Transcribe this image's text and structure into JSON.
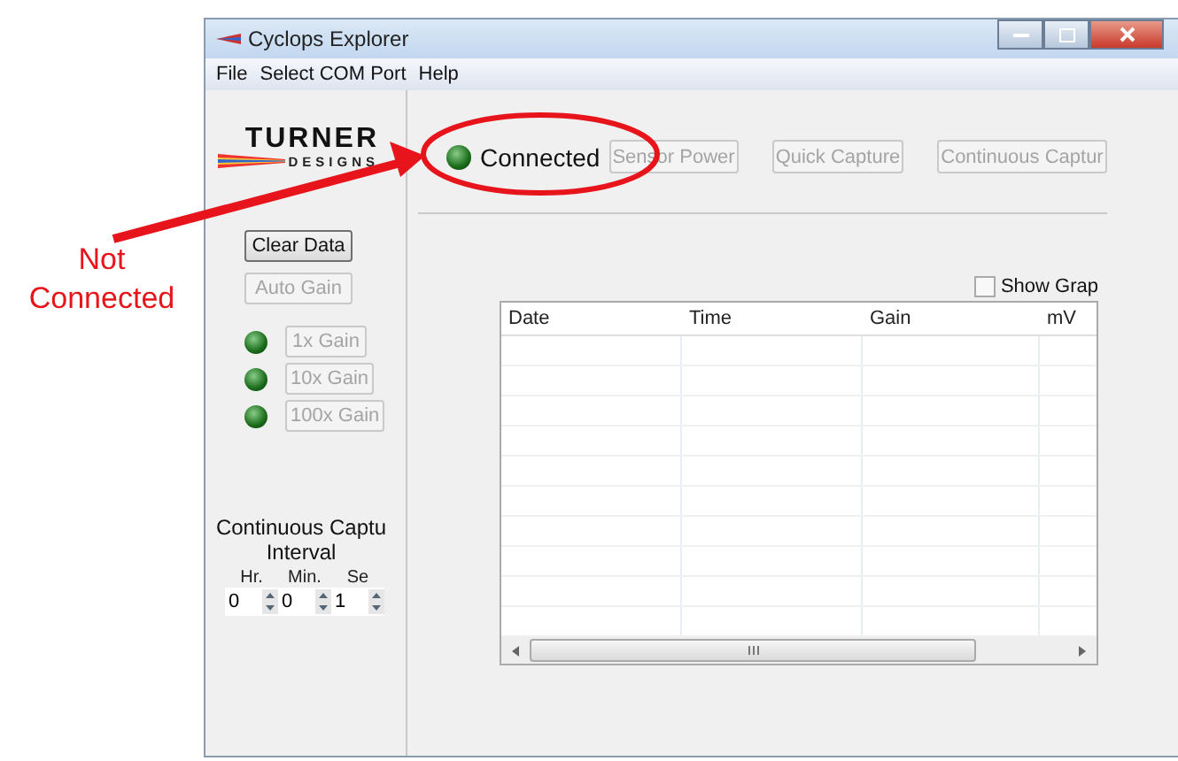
{
  "annotation": {
    "callout": "Not Connected"
  },
  "window": {
    "title": "Cyclops Explorer"
  },
  "menu": [
    "File",
    "Select COM Port",
    "Help"
  ],
  "logo": {
    "line_1": "TURNER",
    "line_2": "DESIGNS"
  },
  "status": {
    "led_on": true,
    "label": "Connected"
  },
  "toolbar_buttons": [
    {
      "label": "Sensor Power",
      "disabled": true
    },
    {
      "label": "Quick Capture",
      "disabled": true
    },
    {
      "label": "Continuous Captur",
      "disabled": true
    }
  ],
  "side_buttons": [
    {
      "label": "Clear Data",
      "disabled": false
    },
    {
      "label": "Auto Gain",
      "disabled": true
    }
  ],
  "gains": [
    {
      "label": "1x Gain",
      "led_on": true,
      "disabled": true
    },
    {
      "label": "10x Gain",
      "led_on": true,
      "disabled": true
    },
    {
      "label": "100x Gain",
      "led_on": true,
      "disabled": true
    }
  ],
  "interval": {
    "title_1": "Continuous Captu",
    "title_2": "Interval",
    "fields": [
      {
        "label": "Hr.",
        "value": "0"
      },
      {
        "label": "Min.",
        "value": "0"
      },
      {
        "label": "Se",
        "value": "1"
      }
    ]
  },
  "show_graph": {
    "label": "Show Grap",
    "checked": false
  },
  "table": {
    "columns": [
      "Date",
      "Time",
      "Gain",
      "mV"
    ]
  }
}
